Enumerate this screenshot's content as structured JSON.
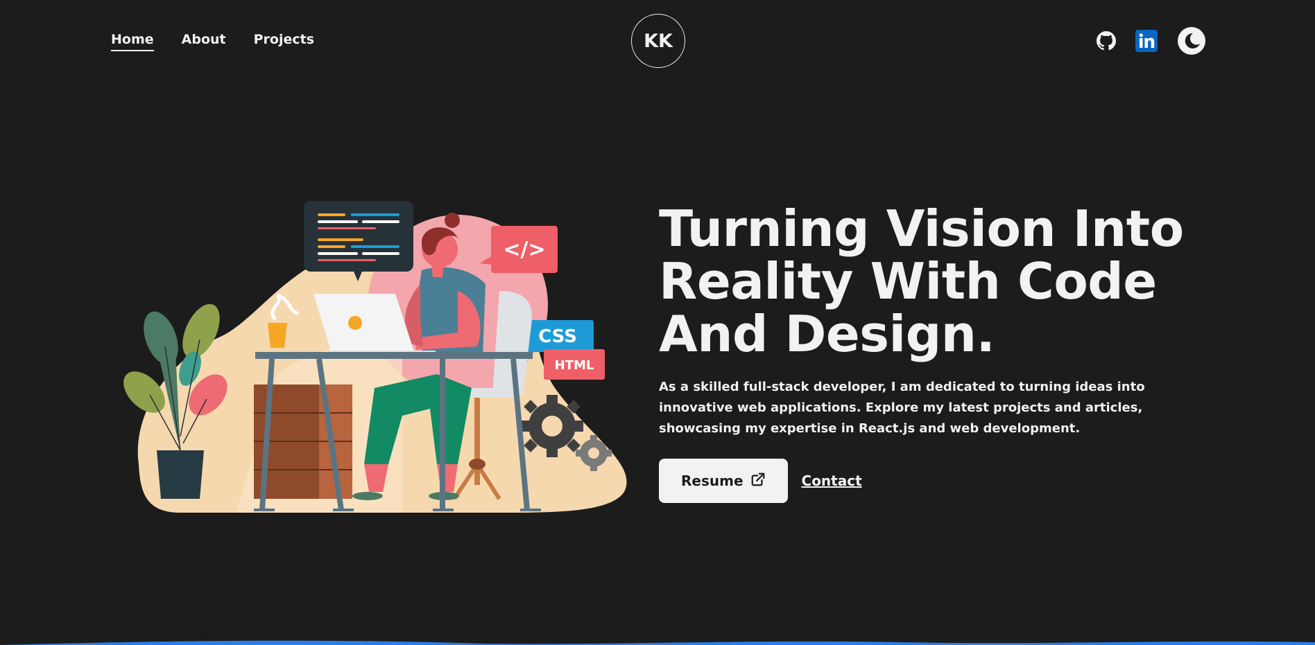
{
  "nav": {
    "links": [
      {
        "label": "Home",
        "active": true
      },
      {
        "label": "About",
        "active": false
      },
      {
        "label": "Projects",
        "active": false
      }
    ],
    "logo": "KK",
    "icons": [
      "github-icon",
      "linkedin-icon",
      "moon-icon"
    ]
  },
  "hero": {
    "headline_line1": "Turning Vision Into",
    "headline_line2": "Reality With Code",
    "headline_line3": "And Design.",
    "tagline": "As a skilled full-stack developer, I am dedicated to turning ideas into innovative web applications. Explore my latest projects and articles, showcasing my expertise in React.js and web development.",
    "resume_label": "Resume",
    "contact_label": "Contact"
  },
  "illustration": {
    "code_tag": "</>",
    "css_label": "CSS",
    "html_label": "HTML"
  },
  "colors": {
    "background": "#1c1c1c",
    "text": "#f2f2f2",
    "accent_blue": "#2b7de9",
    "linkedin": "#0a66c2"
  }
}
